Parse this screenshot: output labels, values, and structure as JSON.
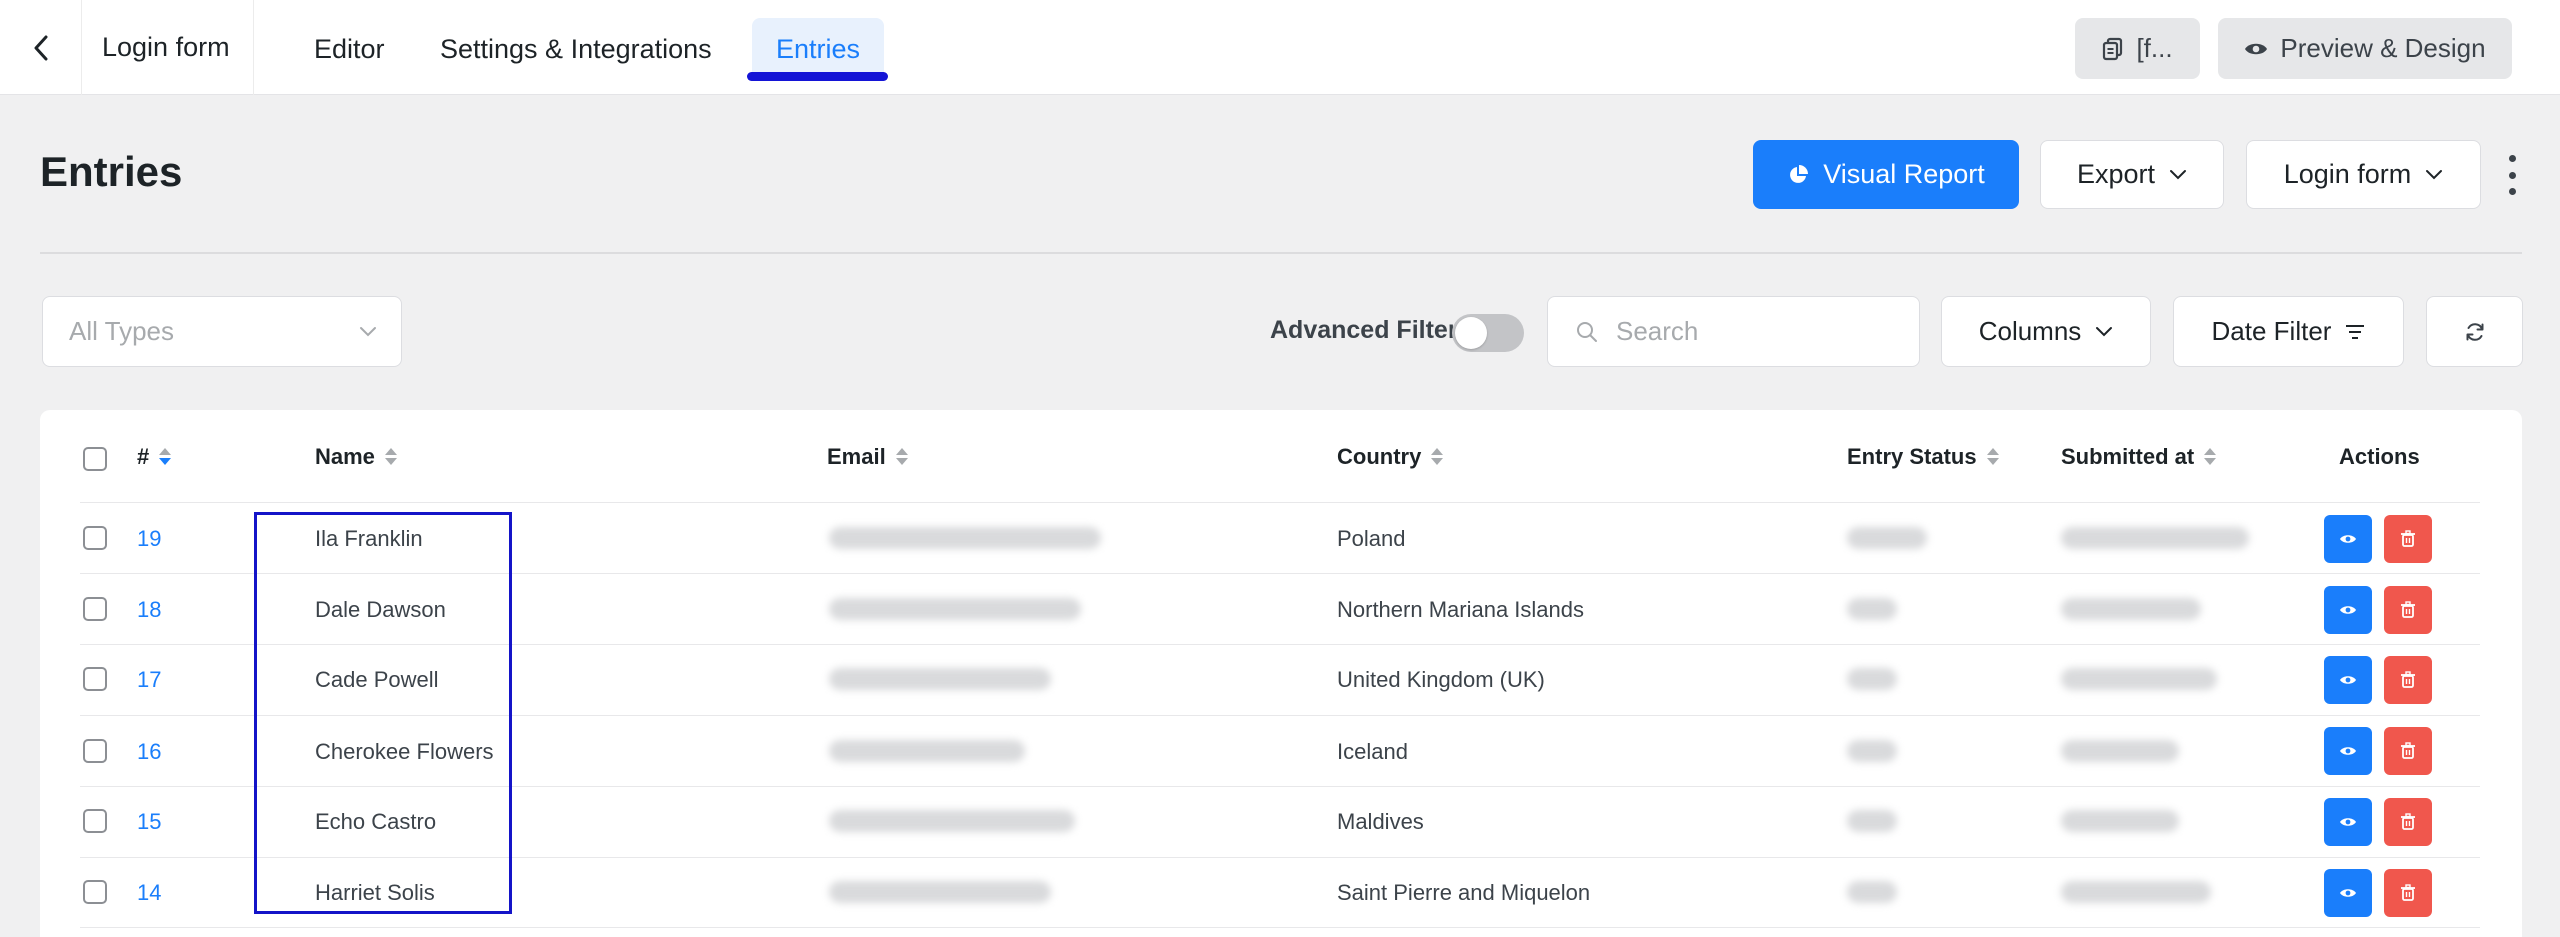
{
  "topbar": {
    "form_name": "Login form",
    "tabs": [
      {
        "label": "Editor"
      },
      {
        "label": "Settings & Integrations"
      },
      {
        "label": "Entries",
        "active": true
      }
    ],
    "shortcode_label": "[f...",
    "preview_label": "Preview & Design"
  },
  "header": {
    "title": "Entries",
    "visual_report_label": "Visual Report",
    "export_label": "Export",
    "form_select_label": "Login form"
  },
  "filters": {
    "type_placeholder": "All Types",
    "advanced_filter_label": "Advanced Filter",
    "advanced_filter_on": false,
    "search_placeholder": "Search",
    "columns_label": "Columns",
    "date_filter_label": "Date Filter"
  },
  "table": {
    "columns": {
      "id": "#",
      "name": "Name",
      "email": "Email",
      "country": "Country",
      "status": "Entry Status",
      "submitted": "Submitted at",
      "actions": "Actions"
    },
    "rows": [
      {
        "id": "19",
        "name": "Ila Franklin",
        "country": "Poland"
      },
      {
        "id": "18",
        "name": "Dale Dawson",
        "country": "Northern Mariana Islands"
      },
      {
        "id": "17",
        "name": "Cade Powell",
        "country": "United Kingdom (UK)"
      },
      {
        "id": "16",
        "name": "Cherokee Flowers",
        "country": "Iceland"
      },
      {
        "id": "15",
        "name": "Echo Castro",
        "country": "Maldives"
      },
      {
        "id": "14",
        "name": "Harriet Solis",
        "country": "Saint Pierre and Miquelon"
      }
    ]
  },
  "colors": {
    "accent": "#1a7efb",
    "danger": "#f0574d",
    "highlight_box": "#1414c8",
    "tab_underline": "#1414d6"
  }
}
